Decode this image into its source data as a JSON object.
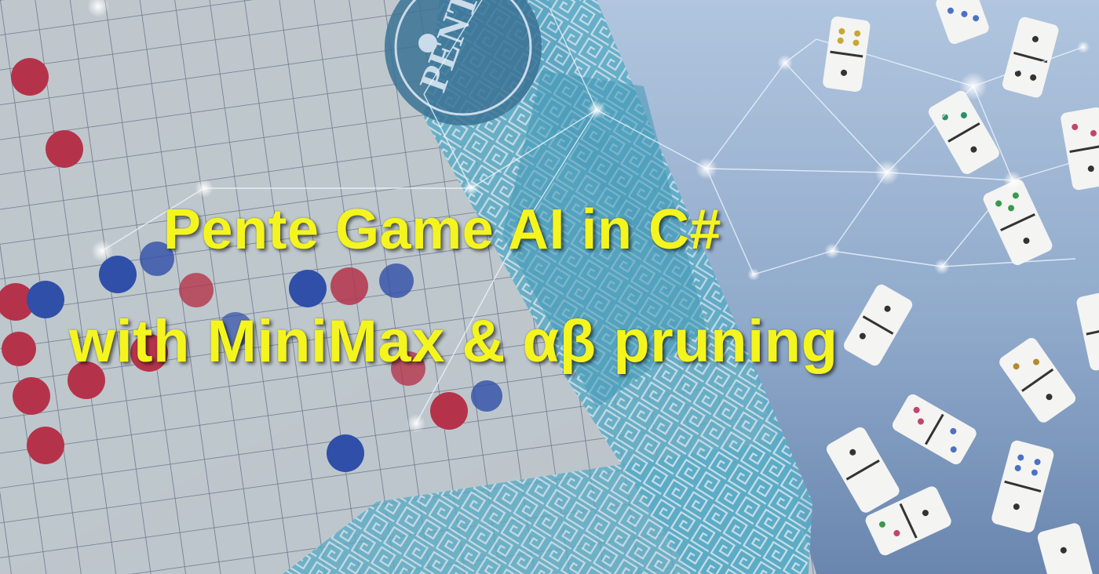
{
  "banner": {
    "title_line1": "Pente Game AI in C#",
    "title_line2": "with MiniMax & αβ pruning",
    "board_logo_text": "PENTE"
  },
  "colors": {
    "title": "#f5f51e",
    "board_paper": "#e3e1d6",
    "board_border": "#57b8c8",
    "red_stone": "#b5334a",
    "blue_stone": "#2f4fa8",
    "network_glow": "#eaf6ff"
  },
  "icons": {
    "red_stones": "red-stone",
    "blue_stones": "blue-stone",
    "dominoes": "domino-tile",
    "network": "neural-network-overlay"
  }
}
